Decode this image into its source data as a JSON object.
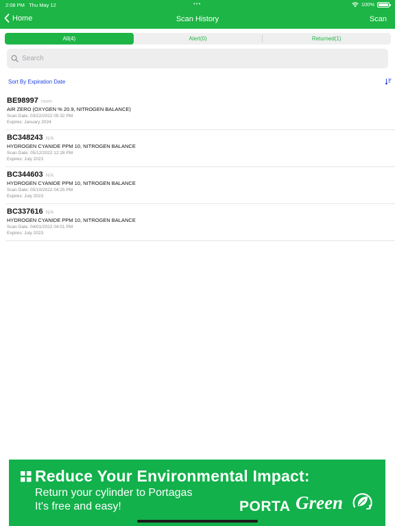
{
  "status": {
    "time": "2:08 PM",
    "date": "Thu May 12",
    "battery": "100%",
    "battery_level": 100
  },
  "nav": {
    "back_label": "Home",
    "title": "Scan History",
    "action_label": "Scan"
  },
  "segments": [
    {
      "label": "All(4)",
      "active": true
    },
    {
      "label": "Alert(0)",
      "active": false
    },
    {
      "label": "Returned(1)",
      "active": false
    }
  ],
  "search": {
    "placeholder": "Search",
    "value": ""
  },
  "sort": {
    "label": "Sort By Expiration Date",
    "icon": "sort-icon"
  },
  "scans": [
    {
      "id": "BE98997",
      "location": "room",
      "description": "AIR ZERO (OXYGEN % 20.9, NITROGEN BALANCE)",
      "scan_date": "Scan Date: 03/22/2022 05:32 PM",
      "expires": "Expires: January 2024"
    },
    {
      "id": "BC348243",
      "location": "N/A",
      "description": "HYDROGEN CYANIDE PPM 10, NITROGEN BALANCE",
      "scan_date": "Scan Date: 05/12/2022 12:28 PM",
      "expires": "Expires: July 2023"
    },
    {
      "id": "BC344603",
      "location": "N/A",
      "description": "HYDROGEN CYANIDE PPM 10, NITROGEN BALANCE",
      "scan_date": "Scan Date: 05/10/2022 04:25 PM",
      "expires": "Expires: July 2023"
    },
    {
      "id": "BC337616",
      "location": "N/A",
      "description": "HYDROGEN CYANIDE PPM 10, NITROGEN BALANCE",
      "scan_date": "Scan Date: 04/01/2022 04:01 PM",
      "expires": "Expires: July 2023"
    }
  ],
  "banner": {
    "headline": "Reduce Your Environmental  Impact:",
    "line1": "Return your cylinder to Portagas",
    "line2": "It's free and easy!",
    "logo_porta": "PORTA",
    "logo_green": "Green",
    "tm": "TM"
  },
  "colors": {
    "brand_green": "#1db545",
    "banner_green": "#12b14b",
    "link_blue": "#1f3fe0"
  }
}
